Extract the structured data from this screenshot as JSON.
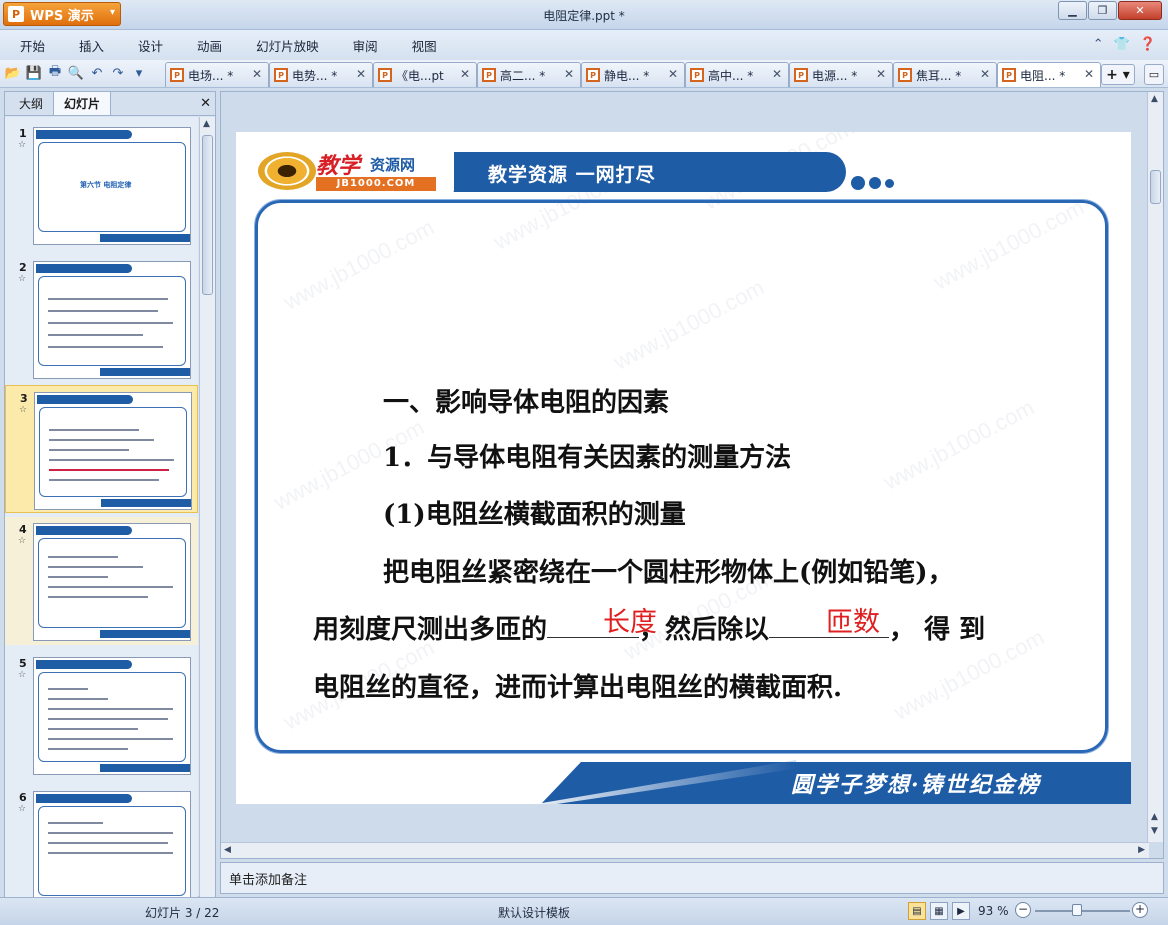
{
  "app": {
    "name": "WPS 演示",
    "window_title": "电阻定律.ppt *"
  },
  "menu": [
    "开始",
    "插入",
    "设计",
    "动画",
    "幻灯片放映",
    "审阅",
    "视图"
  ],
  "doc_tabs": [
    "电场... *",
    "电势... *",
    "《电...pt",
    "高二... *",
    "静电... *",
    "高中... *",
    "电源... *",
    "焦耳... *",
    "电阻... *"
  ],
  "active_tab_index": 8,
  "left_panel": {
    "tabs": [
      "大纲",
      "幻灯片"
    ],
    "active_tab": "幻灯片",
    "slides": [
      {
        "num": "1",
        "title": "第六节  电阻定律"
      },
      {
        "num": "2"
      },
      {
        "num": "3"
      },
      {
        "num": "4"
      },
      {
        "num": "5"
      },
      {
        "num": "6"
      }
    ],
    "selected_slide": 3
  },
  "slide": {
    "header_slogan": "教学资源  一网打尽",
    "logo_text": "教学",
    "logo_text2": "资源网",
    "logo_url": "JB1000.COM",
    "footer_text": "圆学子梦想·铸世纪金榜",
    "watermark": "www.jb1000.com",
    "heading": "一、影响导体电阻的因素",
    "subheading": "1．与导体电阻有关因素的测量方法",
    "section": "(1)电阻丝横截面积的测量",
    "para_line1": "把电阻丝紧密绕在一个圆柱形物体上(例如铅笔)，",
    "para_line2_a": "用刻度尺测出多匝的",
    "para_line2_b": "，然后除以",
    "para_line2_c": "， 得 到",
    "answer1": "长度",
    "answer2": "匝数",
    "para_line3": "电阻丝的直径，进而计算出电阻丝的横截面积."
  },
  "notes_placeholder": "单击添加备注",
  "status": {
    "slide_indicator": "幻灯片 3 / 22",
    "template": "默认设计模板",
    "zoom": "93 %"
  }
}
